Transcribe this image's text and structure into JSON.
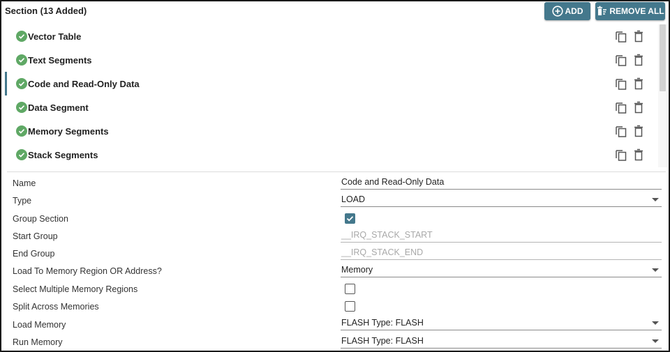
{
  "header": {
    "title": "Section (13 Added)",
    "add_label": "ADD",
    "remove_all_label": "REMOVE ALL"
  },
  "sections": [
    {
      "label": "Vector Table",
      "status": "complete"
    },
    {
      "label": "Text Segments",
      "status": "complete"
    },
    {
      "label": "Code and Read-Only Data",
      "status": "complete",
      "selected": true
    },
    {
      "label": "Data Segment",
      "status": "complete"
    },
    {
      "label": "Memory Segments",
      "status": "complete"
    },
    {
      "label": "Stack Segments",
      "status": "complete"
    }
  ],
  "properties": {
    "name": {
      "label": "Name",
      "value": "Code and Read-Only Data"
    },
    "type": {
      "label": "Type",
      "value": "LOAD"
    },
    "group_section": {
      "label": "Group Section",
      "checked": true
    },
    "start_group": {
      "label": "Start Group",
      "placeholder": "__IRQ_STACK_START"
    },
    "end_group": {
      "label": "End Group",
      "placeholder": "__IRQ_STACK_END"
    },
    "load_to": {
      "label": "Load To Memory Region OR Address?",
      "value": "Memory"
    },
    "select_multiple": {
      "label": "Select Multiple Memory Regions",
      "checked": false
    },
    "split_across": {
      "label": "Split Across Memories",
      "checked": false
    },
    "load_memory": {
      "label": "Load Memory",
      "value": "FLASH Type: FLASH"
    },
    "run_memory": {
      "label": "Run Memory",
      "value": "FLASH Type: FLASH"
    }
  },
  "colors": {
    "accent": "#44788c",
    "success": "#5fa865"
  },
  "icons": {
    "add": "add-circle-icon",
    "remove_all": "clear-all-icon",
    "status": "check-circle-icon",
    "duplicate": "copy-icon",
    "delete": "trash-icon"
  }
}
